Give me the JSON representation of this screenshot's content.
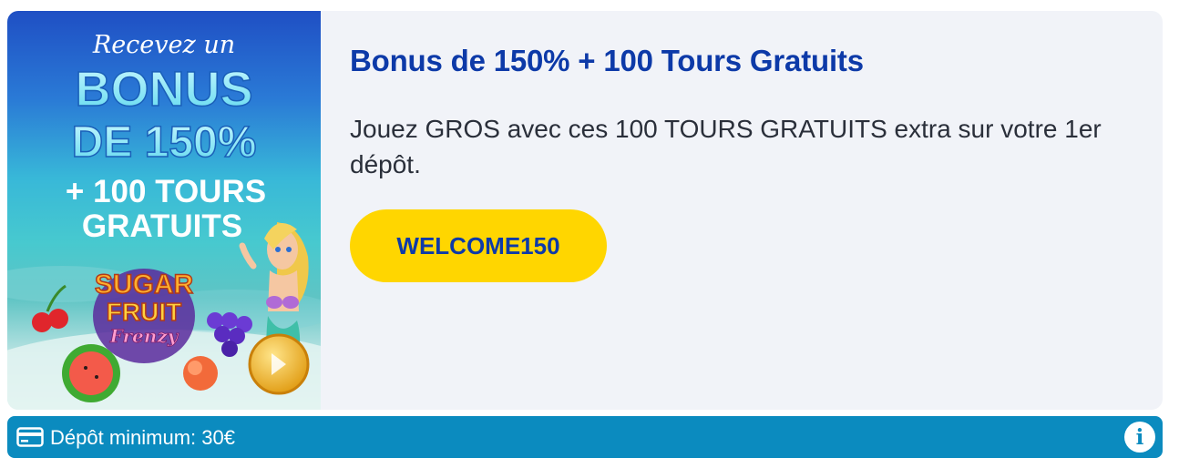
{
  "promo": {
    "image": {
      "line1": "Recevez un",
      "line2": "BONUS",
      "line3": "DE 150%",
      "line4": "+ 100 TOURS",
      "line5": "GRATUITS",
      "logo_top": "SUGAR",
      "logo_mid": "FRUIT",
      "logo_bottom": "Frenzy"
    },
    "title": "Bonus de 150% + 100 Tours Gratuits",
    "description": "Jouez GROS avec ces 100 TOURS GRATUITS extra sur votre 1er dépôt.",
    "code_label": "WELCOME150"
  },
  "footer": {
    "card_icon": "credit-card-icon",
    "deposit_text": "Dépôt minimum: 30€",
    "info_icon": "info-icon",
    "info_symbol": "i"
  },
  "colors": {
    "title": "#0d3aa8",
    "button": "#ffd600",
    "bar": "#0b8bbf",
    "card_bg": "#f1f3f8"
  }
}
